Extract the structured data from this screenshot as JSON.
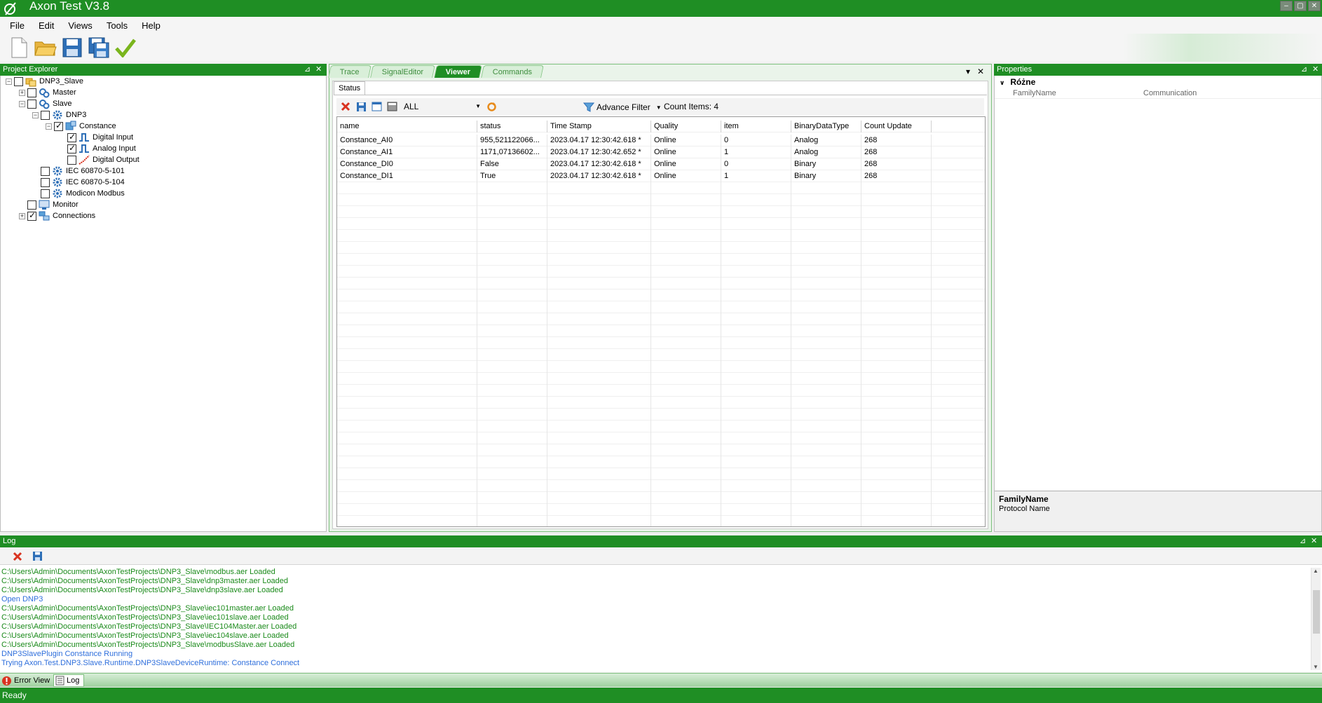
{
  "window": {
    "title": "Axon Test V3.8"
  },
  "menu": [
    "File",
    "Edit",
    "Views",
    "Tools",
    "Help"
  ],
  "project_explorer": {
    "title": "Project Explorer",
    "tree": [
      {
        "label": "DNP3_Slave",
        "level": 0,
        "expander": "minus",
        "checked": false,
        "icon": "project-icon"
      },
      {
        "label": "Master",
        "level": 1,
        "expander": "plus",
        "checked": false,
        "icon": "gears-icon"
      },
      {
        "label": "Slave",
        "level": 1,
        "expander": "minus",
        "checked": false,
        "icon": "gears-icon"
      },
      {
        "label": "DNP3",
        "level": 2,
        "expander": "minus",
        "checked": false,
        "icon": "gear-icon"
      },
      {
        "label": "Constance",
        "level": 3,
        "expander": "minus",
        "checked": true,
        "icon": "device-icon"
      },
      {
        "label": "Digital Input",
        "level": 4,
        "expander": "",
        "checked": true,
        "icon": "digital-signal-icon"
      },
      {
        "label": "Analog Input",
        "level": 4,
        "expander": "",
        "checked": true,
        "icon": "digital-signal-icon"
      },
      {
        "label": "Digital Output",
        "level": 4,
        "expander": "",
        "checked": false,
        "icon": "output-signal-icon"
      },
      {
        "label": "IEC 60870-5-101",
        "level": 2,
        "expander": "",
        "checked": false,
        "icon": "gear-icon"
      },
      {
        "label": "IEC 60870-5-104",
        "level": 2,
        "expander": "",
        "checked": false,
        "icon": "gear-icon"
      },
      {
        "label": "Modicon Modbus",
        "level": 2,
        "expander": "",
        "checked": false,
        "icon": "gear-icon"
      },
      {
        "label": "Monitor",
        "level": 1,
        "expander": "",
        "checked": false,
        "icon": "monitor-icon"
      },
      {
        "label": "Connections",
        "level": 1,
        "expander": "plus",
        "checked": true,
        "icon": "connections-icon"
      }
    ]
  },
  "center": {
    "tabs": [
      {
        "label": "Trace",
        "active": false
      },
      {
        "label": "SignalEditor",
        "active": false
      },
      {
        "label": "Viewer",
        "active": true
      },
      {
        "label": "Commands",
        "active": false
      }
    ],
    "subtab": "Status",
    "filter_value": "ALL",
    "advance_filter_label": "Advance Filter",
    "count_items_label": "Count Items: 4",
    "columns": [
      "name",
      "status",
      "Time Stamp",
      "Quality",
      "item",
      "BinaryDataType",
      "Count Update"
    ],
    "rows": [
      [
        "Constance_AI0",
        "955,521122066...",
        "2023.04.17 12:30:42.618 *",
        "Online",
        "0",
        "Analog",
        "268"
      ],
      [
        "Constance_AI1",
        "1171,07136602...",
        "2023.04.17 12:30:42.652 *",
        "Online",
        "1",
        "Analog",
        "268"
      ],
      [
        "Constance_DI0",
        "False",
        "2023.04.17 12:30:42.618 *",
        "Online",
        "0",
        "Binary",
        "268"
      ],
      [
        "Constance_DI1",
        "True",
        "2023.04.17 12:30:42.618 *",
        "Online",
        "1",
        "Binary",
        "268"
      ]
    ]
  },
  "properties": {
    "title": "Properties",
    "category": "Różne",
    "prop_name": "FamilyName",
    "prop_value": "Communication",
    "desc_title": "FamilyName",
    "desc_text": "Protocol Name"
  },
  "log": {
    "title": "Log",
    "lines": [
      {
        "text": "C:\\Users\\Admin\\Documents\\AxonTestProjects\\DNP3_Slave\\modbus.aer Loaded",
        "color": "#1a8a1a"
      },
      {
        "text": "C:\\Users\\Admin\\Documents\\AxonTestProjects\\DNP3_Slave\\dnp3master.aer Loaded",
        "color": "#1a8a1a"
      },
      {
        "text": "C:\\Users\\Admin\\Documents\\AxonTestProjects\\DNP3_Slave\\dnp3slave.aer Loaded",
        "color": "#1a8a1a"
      },
      {
        "text": "Open DNP3",
        "color": "#2f6fdc"
      },
      {
        "text": "C:\\Users\\Admin\\Documents\\AxonTestProjects\\DNP3_Slave\\iec101master.aer Loaded",
        "color": "#1a8a1a"
      },
      {
        "text": "C:\\Users\\Admin\\Documents\\AxonTestProjects\\DNP3_Slave\\iec101slave.aer Loaded",
        "color": "#1a8a1a"
      },
      {
        "text": "C:\\Users\\Admin\\Documents\\AxonTestProjects\\DNP3_Slave\\IEC104Master.aer Loaded",
        "color": "#1a8a1a"
      },
      {
        "text": "C:\\Users\\Admin\\Documents\\AxonTestProjects\\DNP3_Slave\\iec104slave.aer Loaded",
        "color": "#1a8a1a"
      },
      {
        "text": "C:\\Users\\Admin\\Documents\\AxonTestProjects\\DNP3_Slave\\modbusSlave.aer Loaded",
        "color": "#1a8a1a"
      },
      {
        "text": "DNP3SlavePlugin Constance Running",
        "color": "#2f6fdc"
      },
      {
        "text": "Trying Axon.Test.DNP3.Slave.Runtime.DNP3SlaveDeviceRuntime: Constance Connect",
        "color": "#2f6fdc"
      }
    ]
  },
  "bottom_tabs": [
    "Error View",
    "Log"
  ],
  "status": "Ready",
  "colors": {
    "accent": "#1f8e24",
    "log_green": "#1a8a1a",
    "log_blue": "#2f6fdc"
  }
}
